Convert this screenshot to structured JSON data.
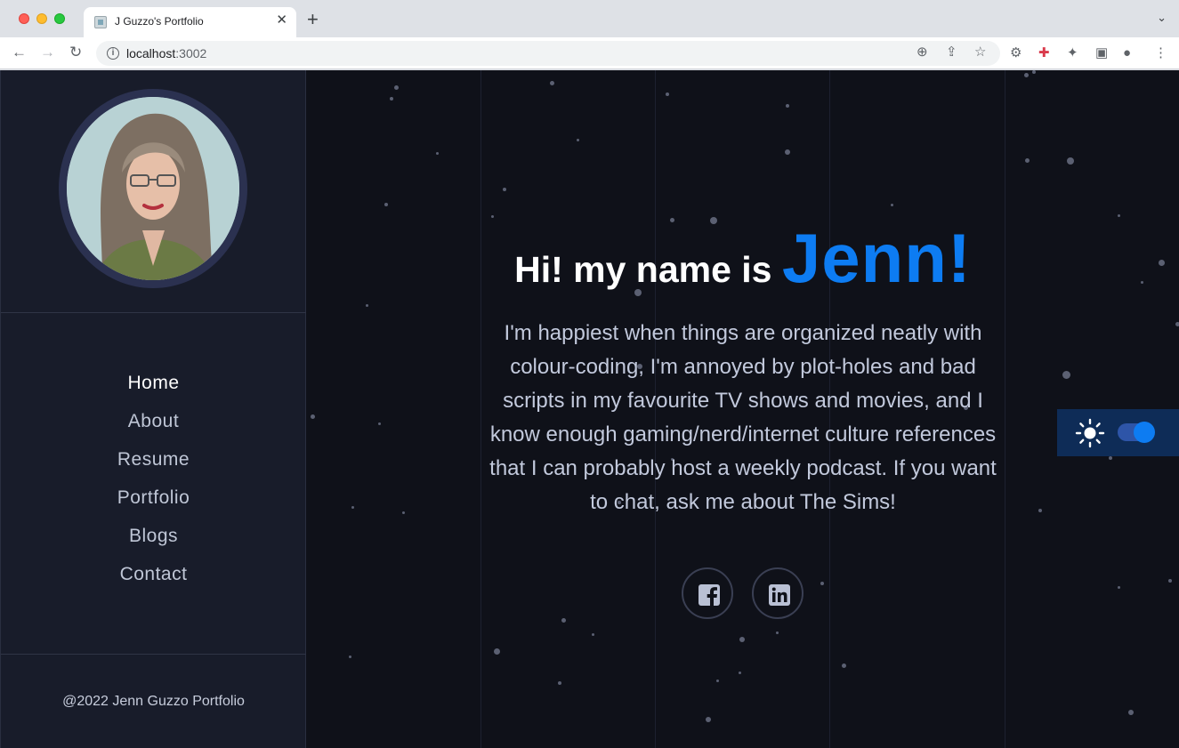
{
  "browser": {
    "tab_title": "J Guzzo's Portfolio",
    "url_host": "localhost",
    "url_port": ":3002"
  },
  "sidebar": {
    "nav": [
      {
        "label": "Home",
        "active": true
      },
      {
        "label": "About",
        "active": false
      },
      {
        "label": "Resume",
        "active": false
      },
      {
        "label": "Portfolio",
        "active": false
      },
      {
        "label": "Blogs",
        "active": false
      },
      {
        "label": "Contact",
        "active": false
      }
    ],
    "footer": "@2022 Jenn Guzzo Portfolio"
  },
  "hero": {
    "greeting": "Hi! my name is ",
    "name": "Jenn!",
    "bio": "I'm happiest when things are organized neatly with colour-coding, I'm annoyed by plot-holes and bad scripts in my favourite TV shows and movies, and I know enough gaming/nerd/internet culture references that I can probably host a weekly podcast. If you want to chat, ask me about The Sims!"
  },
  "socials": [
    {
      "icon": "facebook-icon"
    },
    {
      "icon": "linkedin-icon"
    }
  ],
  "theme_toggle": {
    "icon": "sun-icon",
    "enabled": true
  },
  "colors": {
    "accent": "#0d7cf2",
    "background": "#0f1119",
    "sidebar": "#181c2a"
  }
}
